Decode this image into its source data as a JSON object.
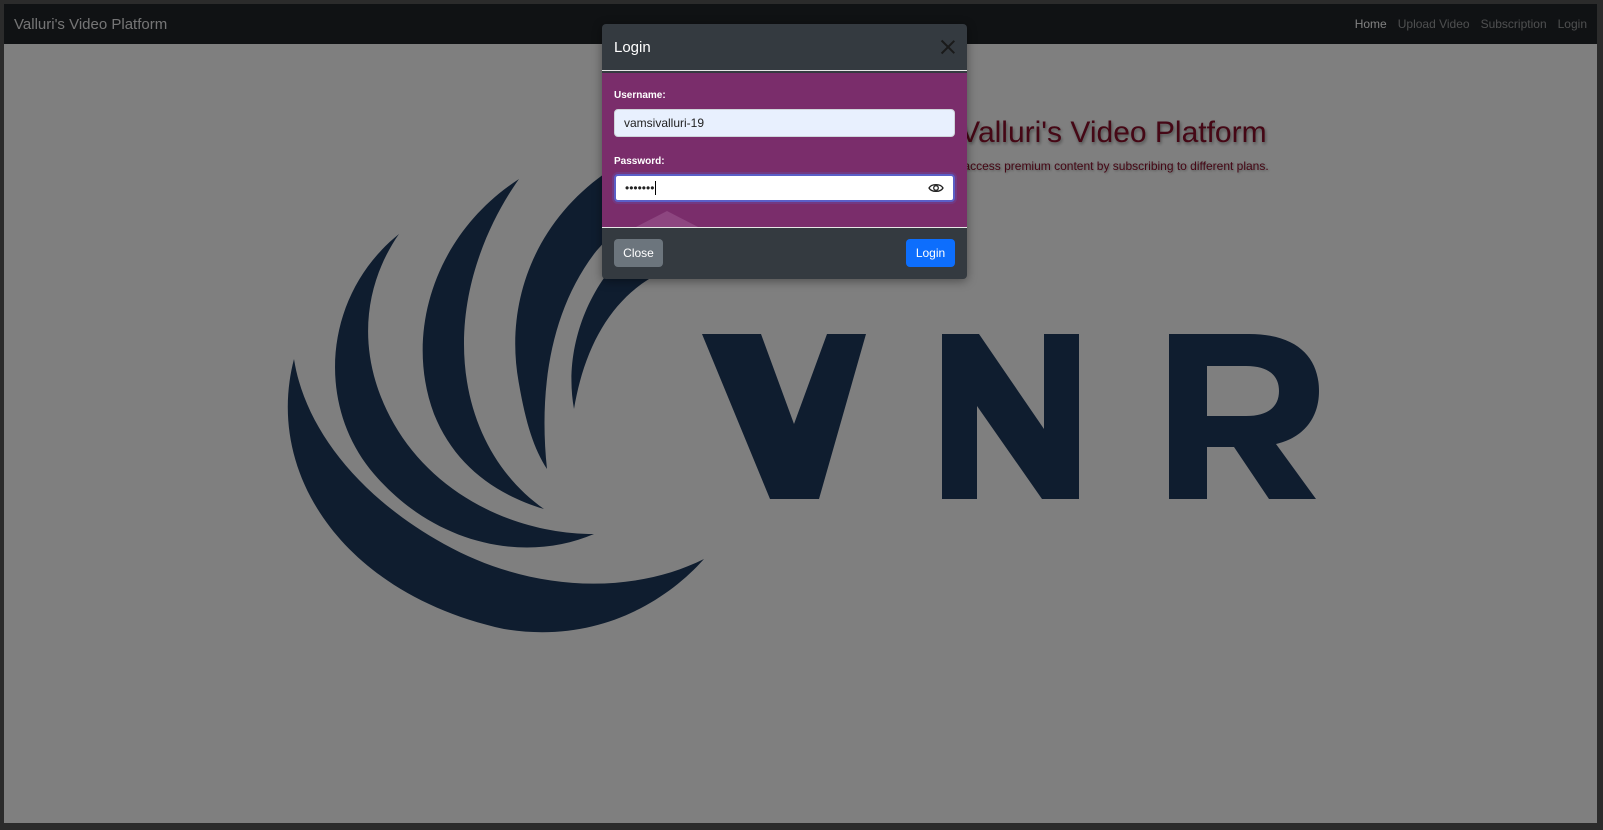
{
  "navbar": {
    "brand": "Valluri's Video Platform",
    "links": [
      {
        "label": "Home",
        "active": true
      },
      {
        "label": "Upload Video",
        "active": false
      },
      {
        "label": "Subscription",
        "active": false
      },
      {
        "label": "Login",
        "active": false
      }
    ]
  },
  "hero": {
    "title": "Welcome to Valluri's Video Platform",
    "subtitle": "Upload, stream videos, and access premium content by subscribing to different plans."
  },
  "logo": {
    "text": "VNR",
    "color": "#1e3a5f"
  },
  "modal": {
    "title": "Login",
    "username_label": "Username:",
    "username_value": "vamsivalluri-19",
    "password_label": "Password:",
    "password_masked": "•••••••",
    "close_button": "Close",
    "login_button": "Login",
    "body_color": "#7a2d6b",
    "header_color": "#343a40"
  },
  "colors": {
    "accent": "#0d6efd",
    "hero_text": "#8b0f2a"
  }
}
